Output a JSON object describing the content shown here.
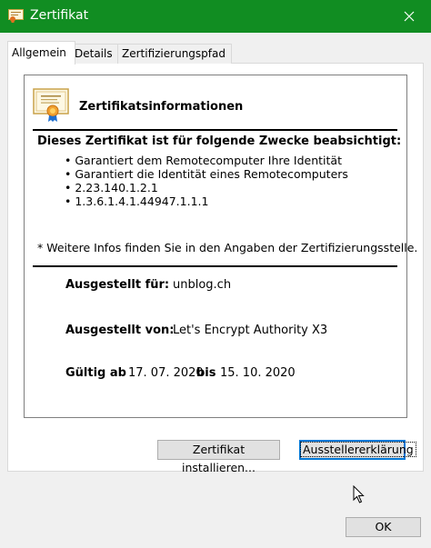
{
  "window": {
    "title": "Zertifikat",
    "title_icon": "certificate-icon",
    "titlebar_color": "#118d22"
  },
  "tabs": [
    {
      "label": "Allgemein",
      "active": true
    },
    {
      "label": "Details",
      "active": false
    },
    {
      "label": "Zertifizierungspfad",
      "active": false
    }
  ],
  "certificate": {
    "info_title": "Zertifikatsinformationen",
    "purpose_heading": "Dieses Zertifikat ist für folgende Zwecke beabsichtigt:",
    "purposes": [
      "Garantiert dem Remotecomputer Ihre Identität",
      "Garantiert die Identität eines Remotecomputers",
      "2.23.140.1.2.1",
      "1.3.6.1.4.1.44947.1.1.1"
    ],
    "note": "* Weitere Infos finden Sie in den Angaben der Zertifizierungsstelle.",
    "issued_to_label": "Ausgestellt für:",
    "issued_to_value": "unblog.ch",
    "issued_by_label": "Ausgestellt von:",
    "issued_by_value": "Let's Encrypt Authority X3",
    "valid_label": "Gültig ab",
    "valid_from": "17. 07. 2020",
    "valid_to_label": "bis",
    "valid_to": "15. 10. 2020"
  },
  "buttons": {
    "install": "Zertifikat installieren...",
    "issuer_statement": "Ausstellererklärung",
    "ok": "OK"
  },
  "accent_color": "#0078d7"
}
